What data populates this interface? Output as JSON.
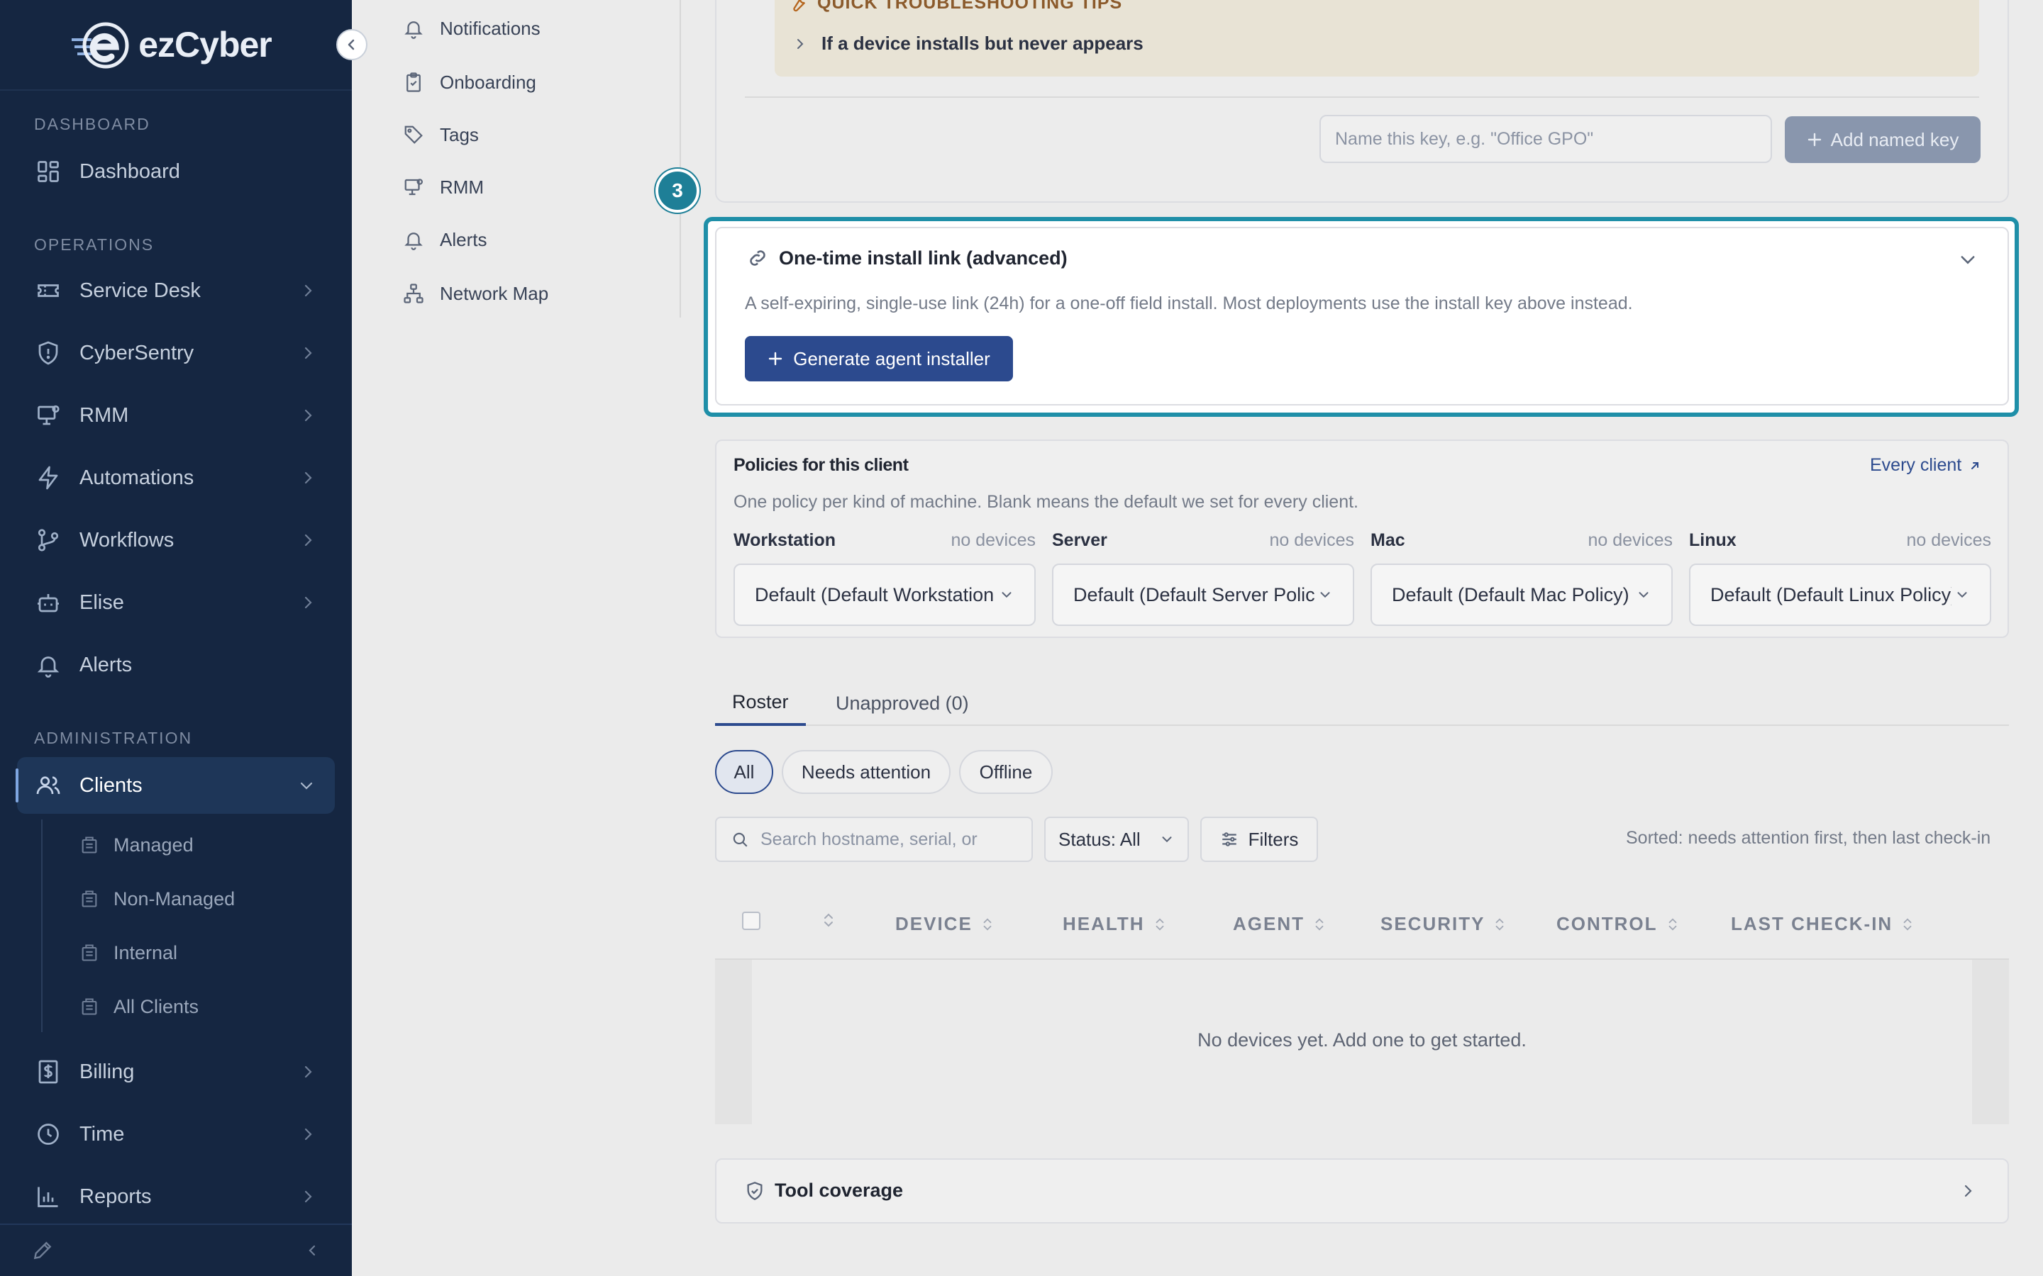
{
  "brand": {
    "logo_text": "ezCyber"
  },
  "sidebar": {
    "sections": {
      "dashboard": "DASHBOARD",
      "operations": "OPERATIONS",
      "administration": "ADMINISTRATION"
    },
    "items": [
      {
        "label": "Dashboard",
        "icon": "grid-icon"
      },
      {
        "label": "Service Desk",
        "icon": "ticket-icon"
      },
      {
        "label": "CyberSentry",
        "icon": "shield-icon"
      },
      {
        "label": "RMM",
        "icon": "monitor-icon"
      },
      {
        "label": "Automations",
        "icon": "bolt-icon"
      },
      {
        "label": "Workflows",
        "icon": "branch-icon"
      },
      {
        "label": "Elise",
        "icon": "bot-icon"
      },
      {
        "label": "Alerts",
        "icon": "bell-icon"
      },
      {
        "label": "Clients",
        "icon": "users-icon"
      },
      {
        "label": "Billing",
        "icon": "dollar-icon"
      },
      {
        "label": "Time",
        "icon": "clock-icon"
      },
      {
        "label": "Reports",
        "icon": "chart-icon"
      }
    ],
    "clients_sub": [
      "Managed",
      "Non-Managed",
      "Internal",
      "All Clients"
    ]
  },
  "subnav": {
    "items": [
      "Notifications",
      "Onboarding",
      "Tags",
      "RMM",
      "Alerts",
      "Network Map"
    ]
  },
  "tips": {
    "title": "QUICK TROUBLESHOOTING TIPS",
    "row": "If a device installs but never appears"
  },
  "named_key": {
    "placeholder": "Name this key, e.g. \"Office GPO\"",
    "button": "Add named key"
  },
  "step": "3",
  "one_time": {
    "title": "One-time install link (advanced)",
    "description": "A self-expiring, single-use link (24h) for a one-off field install. Most deployments use the install key above instead.",
    "button": "Generate agent installer"
  },
  "policies": {
    "title": "Policies for this client",
    "link": "Every client",
    "description": "One policy per kind of machine. Blank means the default we set for every client.",
    "columns": [
      {
        "name": "Workstation",
        "count": "no devices",
        "value": "Default (Default Workstation Policy)"
      },
      {
        "name": "Server",
        "count": "no devices",
        "value": "Default (Default Server Policy)"
      },
      {
        "name": "Mac",
        "count": "no devices",
        "value": "Default (Default Mac Policy)"
      },
      {
        "name": "Linux",
        "count": "no devices",
        "value": "Default (Default Linux Policy)"
      }
    ]
  },
  "tabs": [
    "Roster",
    "Unapproved (0)"
  ],
  "pills": [
    "All",
    "Needs attention",
    "Offline"
  ],
  "toolbar": {
    "search_placeholder": "Search hostname, serial, or",
    "status": "Status: All",
    "filters": "Filters",
    "sorted": "Sorted: needs attention first, then last check-in"
  },
  "table": {
    "headers": [
      "DEVICE",
      "HEALTH",
      "AGENT",
      "SECURITY",
      "CONTROL",
      "LAST CHECK-IN"
    ],
    "empty": "No devices yet. Add one to get started."
  },
  "tool_coverage": {
    "title": "Tool coverage"
  },
  "colors": {
    "sidebar": "#152641",
    "accent": "#2c4a8e",
    "highlight": "#1f8fa8"
  }
}
